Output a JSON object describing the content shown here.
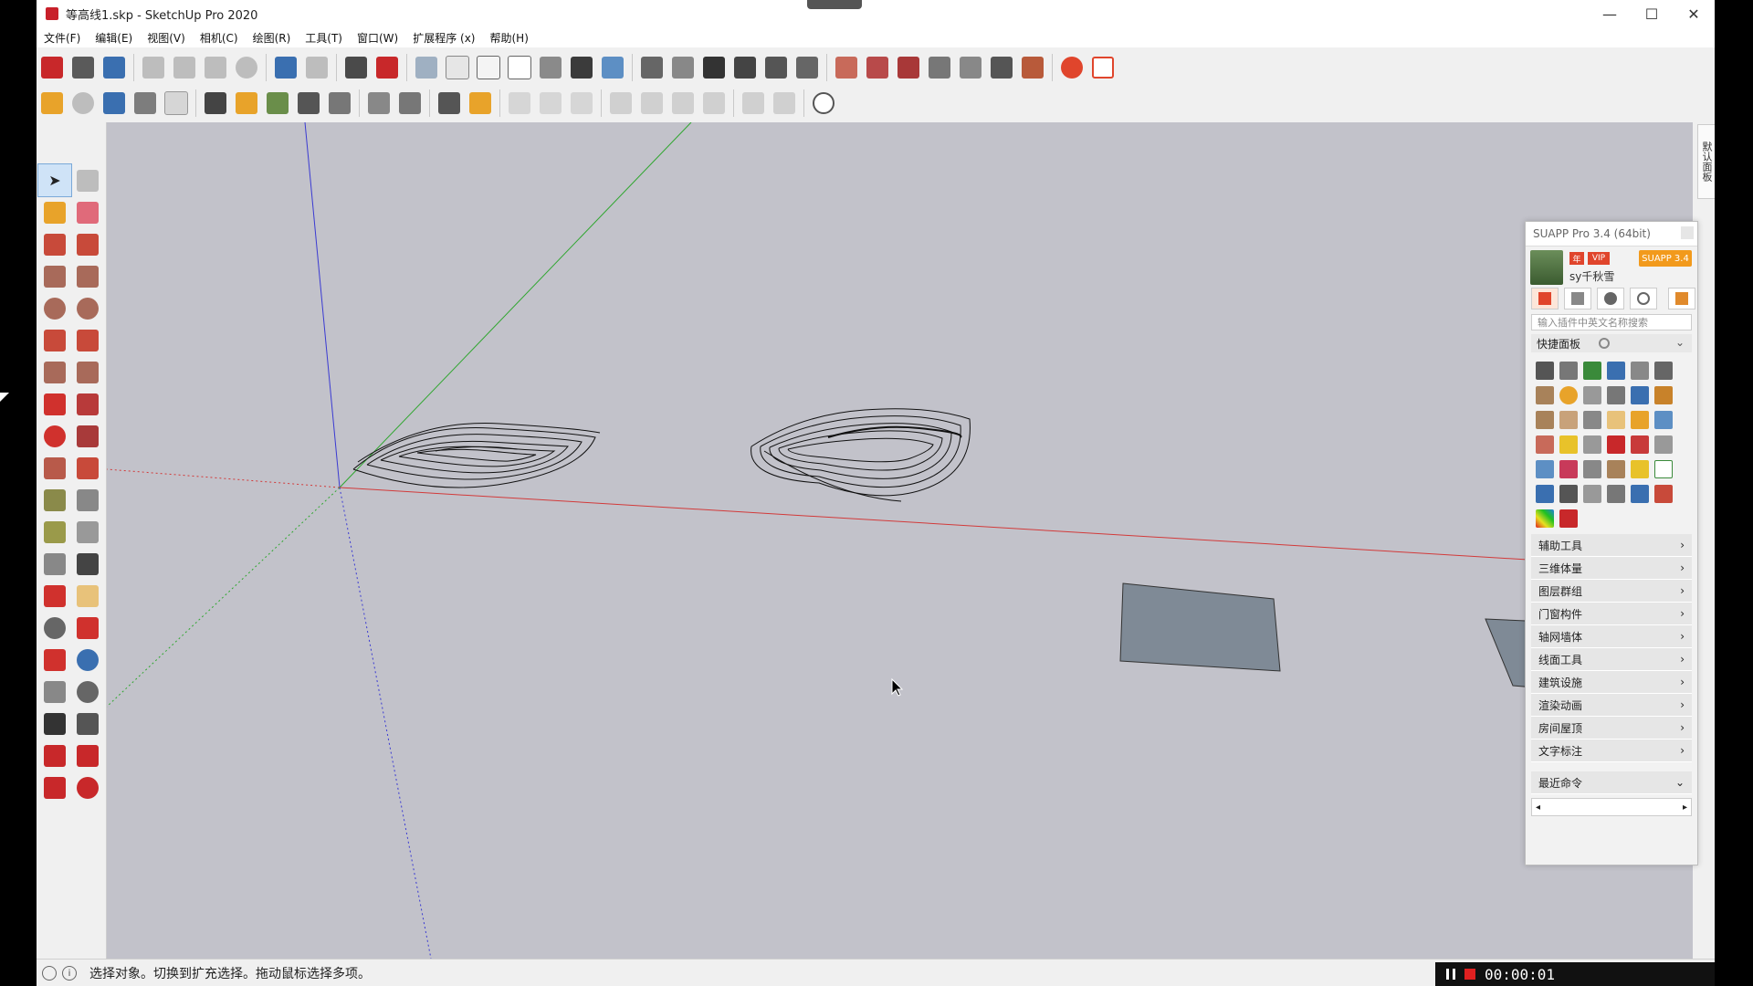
{
  "window": {
    "title": "等高线1.skp - SketchUp Pro 2020",
    "minimize": "—",
    "maximize": "☐",
    "close": "✕"
  },
  "menu": [
    "文件(F)",
    "编辑(E)",
    "视图(V)",
    "相机(C)",
    "绘图(R)",
    "工具(T)",
    "窗口(W)",
    "扩展程序 (x)",
    "帮助(H)"
  ],
  "colors": {
    "viewport": "#c2c2ca",
    "axis_red": "#d23a3a",
    "axis_green": "#2ea62e",
    "axis_blue": "#3a3ad2",
    "face": "#7f8a96"
  },
  "right_tray": {
    "label": "默认面板"
  },
  "suapp": {
    "title": "SUAPP Pro 3.4 (64bit)",
    "badge_nian": "年",
    "badge_vip": "VIP",
    "version_badge": "SUAPP 3.4",
    "username": "sy千秋雪",
    "search_placeholder": "输入插件中英文名称搜索",
    "quick_panel": "快捷面板",
    "categories": [
      "辅助工具",
      "三维体量",
      "图层群组",
      "门窗构件",
      "轴网墙体",
      "线面工具",
      "建筑设施",
      "渲染动画",
      "房间屋顶",
      "文字标注"
    ],
    "recent": "最近命令",
    "chevron": "›",
    "scroll_left": "◂",
    "scroll_right": "▸"
  },
  "status": {
    "text": "选择对象。切换到扩充选择。拖动鼠标选择多项。",
    "info_icon": "i"
  },
  "recorder": {
    "time": "00:00:01"
  }
}
